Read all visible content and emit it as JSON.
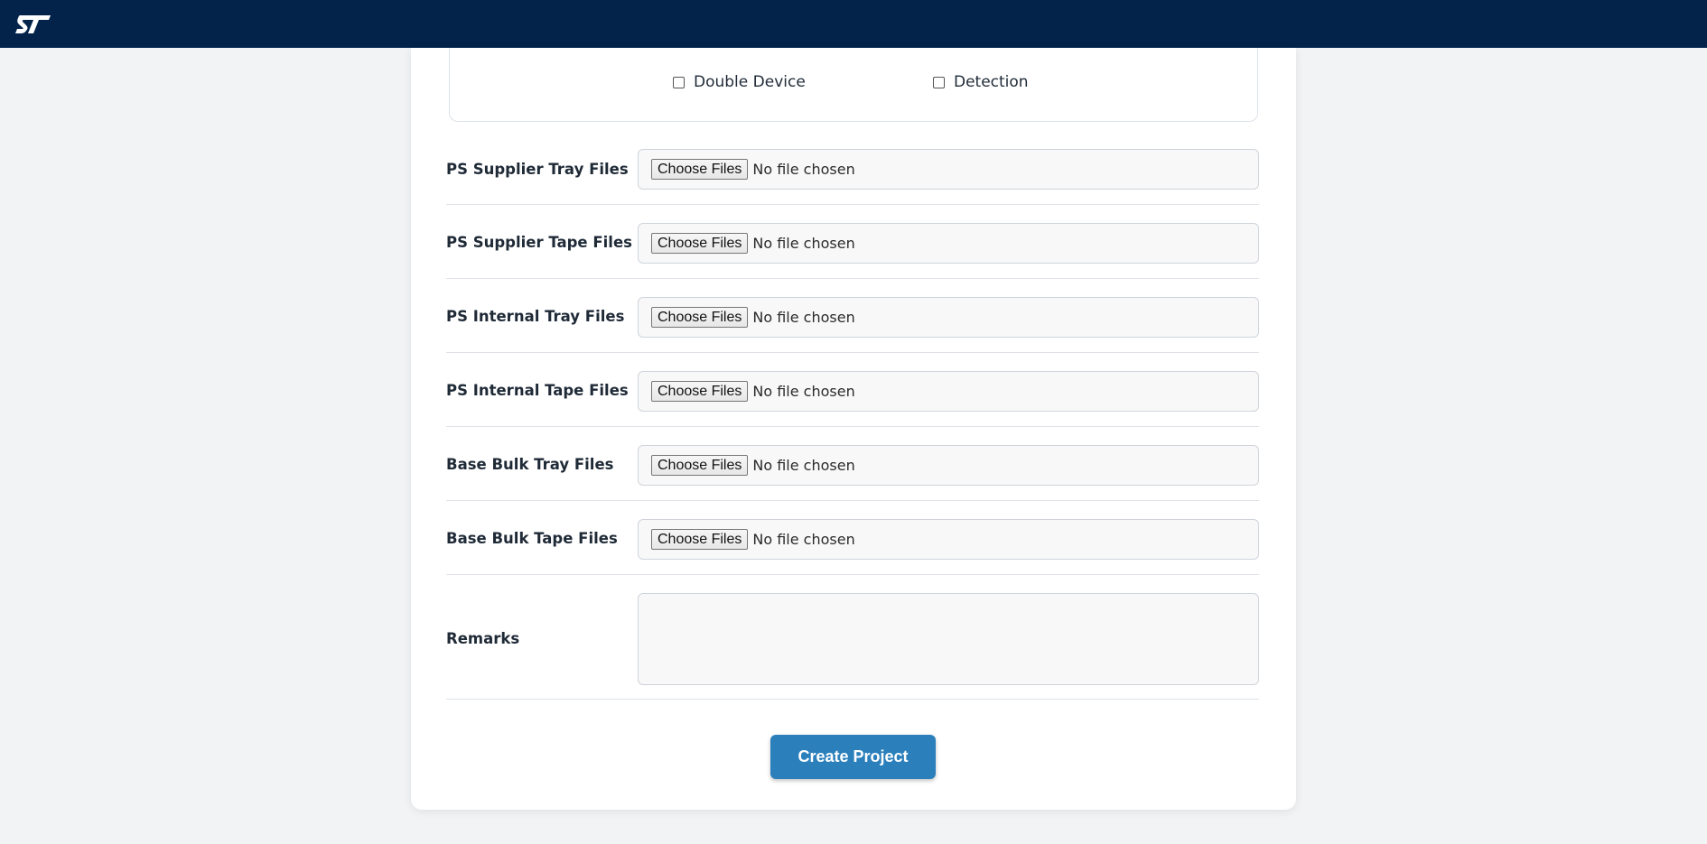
{
  "header": {
    "logo_icon": "st-logo-icon",
    "background_color": "#03234b"
  },
  "options": {
    "double_device": {
      "label": "Double Device",
      "checked": false
    },
    "detection": {
      "label": "Detection",
      "checked": false
    }
  },
  "file_fields": [
    {
      "label": "PS Supplier Tray Files",
      "button": "Choose Files",
      "status": "No file chosen"
    },
    {
      "label": "PS Supplier Tape Files",
      "button": "Choose Files",
      "status": "No file chosen"
    },
    {
      "label": "PS Internal Tray Files",
      "button": "Choose Files",
      "status": "No file chosen"
    },
    {
      "label": "PS Internal Tape Files",
      "button": "Choose Files",
      "status": "No file chosen"
    },
    {
      "label": "Base Bulk Tray Files",
      "button": "Choose Files",
      "status": "No file chosen"
    },
    {
      "label": "Base Bulk Tape Files",
      "button": "Choose Files",
      "status": "No file chosen"
    }
  ],
  "remarks": {
    "label": "Remarks",
    "value": ""
  },
  "submit": {
    "label": "Create Project",
    "color": "#2b80bc"
  }
}
